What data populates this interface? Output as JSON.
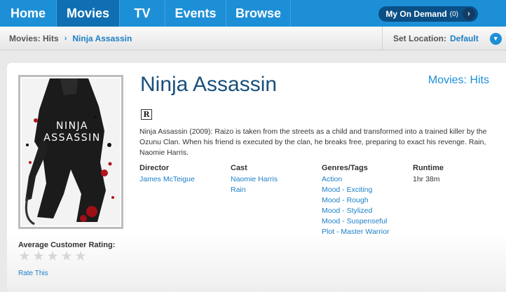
{
  "nav": {
    "tabs": [
      "Home",
      "Movies",
      "TV",
      "Events",
      "Browse"
    ],
    "my_on_demand": {
      "label": "My On Demand",
      "count": "(0)",
      "arrow": "›"
    }
  },
  "breadcrumb": {
    "root": "Movies: Hits",
    "sep": "›",
    "current": "Ninja Assassin"
  },
  "location": {
    "label": "Set Location:",
    "value": "Default"
  },
  "movie": {
    "title": "Ninja Assassin",
    "category_link": "Movies: Hits",
    "rating_badge": "R",
    "description": "Ninja Assassin (2009): Raizo is taken from the streets as a child and transformed into a trained killer by the Ozunu Clan. When his friend is executed by the clan, he breaks free, preparing to exact his revenge. Rain, Naomie Harris.",
    "poster_title_line1": "NINJA",
    "poster_title_line2": "ASSASSIN",
    "director_header": "Director",
    "director": "James McTeigue",
    "cast_header": "Cast",
    "cast": [
      "Naomie Harris",
      "Rain"
    ],
    "genres_header": "Genres/Tags",
    "genres": [
      "Action",
      "Mood - Exciting",
      "Mood - Rough",
      "Mood - Stylized",
      "Mood - Suspenseful",
      "Plot - Master Warrior"
    ],
    "runtime_header": "Runtime",
    "runtime": "1hr 38m"
  },
  "rating": {
    "label": "Average Customer Rating:",
    "stars_filled": 0,
    "stars_total": 5,
    "rate_link": "Rate This"
  },
  "colors": {
    "nav_blue": "#1d8fd6",
    "nav_active": "#0f6fb2",
    "link_blue": "#1d7fc6",
    "title_navy": "#1a4f7c"
  }
}
